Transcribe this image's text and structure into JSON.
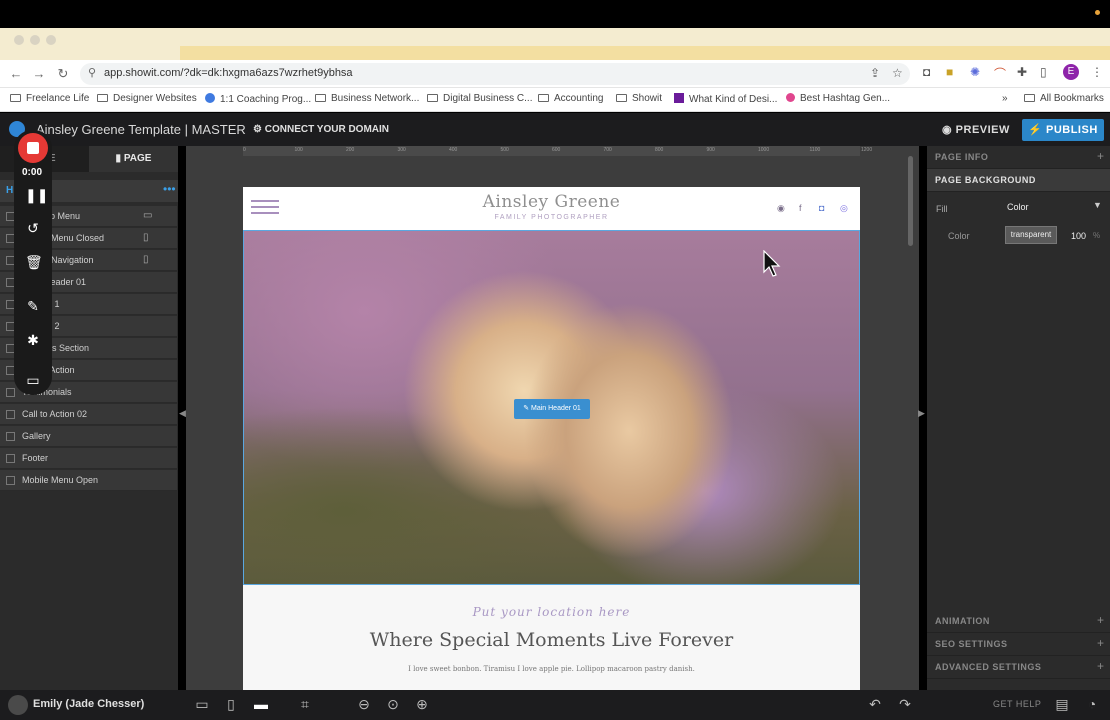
{
  "browser": {
    "url": "app.showit.com/?dk=dk:hxgma6azs7wzrhet9ybhsa",
    "profile_initial": "E",
    "bookmarks": [
      "Freelance Life",
      "Designer Websites",
      "1:1 Coaching Prog...",
      "Business Network...",
      "Digital Business C...",
      "Accounting",
      "Showit",
      "What Kind of Desi...",
      "Best Hashtag Gen..."
    ],
    "bookmarks_more": "»",
    "all_bookmarks": "All Bookmarks"
  },
  "app": {
    "title": "Ainsley Greene Template | MASTER",
    "connect_domain": "CONNECT YOUR DOMAIN",
    "preview": "PREVIEW",
    "publish": "PUBLISH",
    "accent": "#2b87c9"
  },
  "recorder": {
    "time": "0:00"
  },
  "left_panel": {
    "tab_site": "SITE",
    "tab_page": "PAGE",
    "header_label": "H",
    "canvases": [
      {
        "label": "Desktop Menu",
        "device": "desktop"
      },
      {
        "label": "Mobile Menu Closed",
        "device": "mobile"
      },
      {
        "label": "Mobile Navigation",
        "device": "mobile"
      },
      {
        "label": "Main Header 01",
        "device": ""
      },
      {
        "label": "Section 1",
        "device": ""
      },
      {
        "label": "Section 2",
        "device": ""
      },
      {
        "label": "Services Section",
        "device": ""
      },
      {
        "label": "Call to Action",
        "device": ""
      },
      {
        "label": "Testimonials",
        "device": ""
      },
      {
        "label": "Call to Action 02",
        "device": ""
      },
      {
        "label": "Gallery",
        "device": ""
      },
      {
        "label": "Footer",
        "device": ""
      },
      {
        "label": "Mobile Menu Open",
        "device": ""
      }
    ]
  },
  "site": {
    "brand": "Ainsley Greene",
    "brand_sub": "FAMILY PHOTOGRAPHER",
    "hero_badge": "Main Header 01",
    "location": "Put your location here",
    "heading": "Where Special Moments Live Forever",
    "paragraph": "I love sweet bonbon. Tiramisu I love apple pie. Lollipop macaroon pastry danish."
  },
  "ruler": [
    "0",
    "100",
    "200",
    "300",
    "400",
    "500",
    "600",
    "700",
    "800",
    "900",
    "1000",
    "1100",
    "1200"
  ],
  "right_panel": {
    "page_info": "PAGE INFO",
    "page_background": "PAGE BACKGROUND",
    "fill_label": "Fill",
    "fill_value": "Color",
    "color_label": "Color",
    "color_value": "transparent",
    "opacity": "100",
    "opacity_unit": "%",
    "animation": "ANIMATION",
    "seo": "SEO SETTINGS",
    "advanced": "ADVANCED SETTINGS"
  },
  "bottom": {
    "user": "Emily (Jade Chesser)",
    "get_help": "GET HELP"
  }
}
